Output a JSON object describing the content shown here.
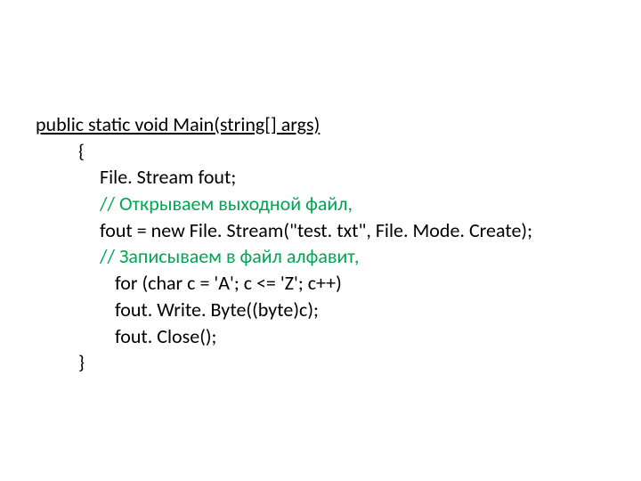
{
  "code": {
    "line1": "public static void Main(string[] args)",
    "line2": "{",
    "line3": "File. Stream fout;",
    "line4": "// Открываем выходной файл,",
    "line5": "fout = new File. Stream(\"test. txt\", File. Mode. Create);",
    "line6": "// Записываем в файл алфавит,",
    "line7": " for (char c = 'A'; c <= 'Z'; c++)",
    "line8": " fout. Write. Byte((byte)c);",
    "line9": " fout. Close();",
    "line10": "}"
  }
}
